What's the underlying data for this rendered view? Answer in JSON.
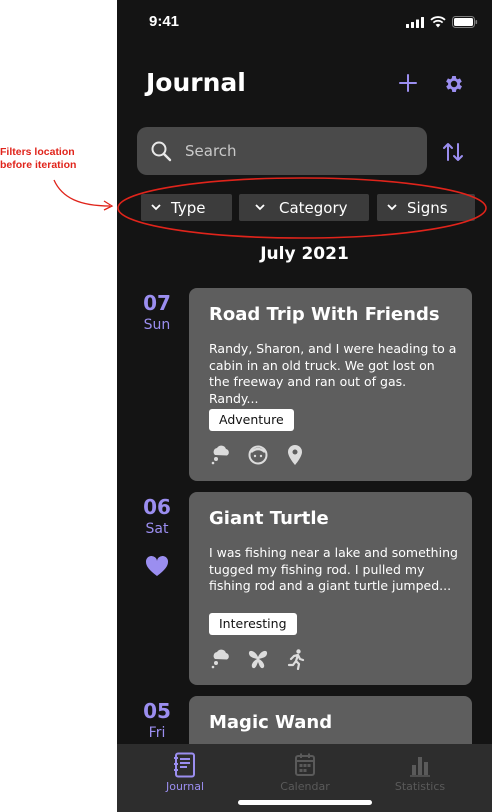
{
  "annotation": {
    "text_line1": "Filters location",
    "text_line2": "before iteration"
  },
  "status": {
    "time": "9:41"
  },
  "header": {
    "title": "Journal",
    "add_icon": "plus-icon",
    "settings_icon": "gear-icon"
  },
  "search": {
    "placeholder": "Search",
    "value": ""
  },
  "filters": [
    {
      "label": "Type"
    },
    {
      "label": "Category"
    },
    {
      "label": "Signs"
    }
  ],
  "month": "July 2021",
  "entries": [
    {
      "day": "07",
      "weekday": "Sun",
      "favorite": false,
      "title": "Road Trip With Friends",
      "body": "Randy, Sharon, and I were heading to a cabin in an old truck. We got lost on the freeway and ran out of gas. Randy...",
      "tag": "Adventure",
      "signs": [
        "thought-cloud-icon",
        "face-icon",
        "location-pin-icon"
      ]
    },
    {
      "day": "06",
      "weekday": "Sat",
      "favorite": true,
      "title": "Giant Turtle",
      "body": "I was fishing near a lake and something tugged my fishing rod. I pulled my fishing rod and a giant turtle jumped...",
      "tag": "Interesting",
      "signs": [
        "thought-cloud-icon",
        "butterfly-icon",
        "running-person-icon"
      ]
    },
    {
      "day": "05",
      "weekday": "Fri",
      "favorite": false,
      "title": "Magic Wand"
    }
  ],
  "tabbar": [
    {
      "label": "Journal",
      "active": true
    },
    {
      "label": "Calendar",
      "active": false
    },
    {
      "label": "Statistics",
      "active": false
    }
  ],
  "colors": {
    "accent": "#9b8ef0",
    "background": "#141414",
    "card": "#5e5e5e",
    "annotation": "#e0241b"
  }
}
